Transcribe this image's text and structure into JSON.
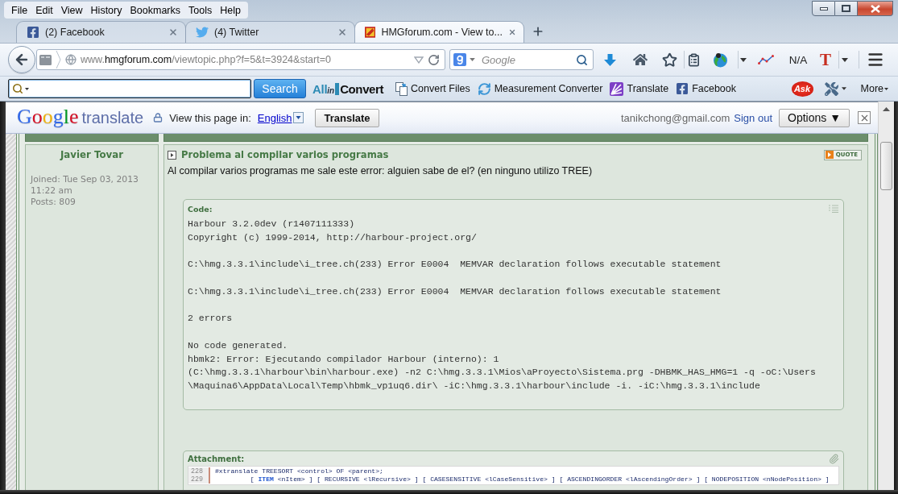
{
  "menu": [
    {
      "label": "File"
    },
    {
      "label": "Edit"
    },
    {
      "label": "View"
    },
    {
      "label": "History"
    },
    {
      "label": "Bookmarks"
    },
    {
      "label": "Tools"
    },
    {
      "label": "Help"
    }
  ],
  "tabs": [
    {
      "label": "(2) Facebook",
      "selected": false
    },
    {
      "label": "(4) Twitter",
      "selected": false
    },
    {
      "label": "HMGforum.com - View to...",
      "selected": true
    }
  ],
  "address_bar": {
    "url_prefix": "www.",
    "url_domain": "hmgforum.com",
    "url_path": "/viewtopic.php?f=5&t=3924&start=0"
  },
  "search_field": {
    "placeholder": "Google"
  },
  "nav_toolbar": {
    "status_text": "N/A",
    "letter_button": "T"
  },
  "bookmarks_bar": {
    "search_button": "Search",
    "logo": {
      "part_1": "All",
      "part_2": "in",
      "part_3": "Convert"
    },
    "items": [
      {
        "label": "Convert Files"
      },
      {
        "label": "Measurement Converter"
      },
      {
        "label": "Translate"
      },
      {
        "label": "Facebook"
      }
    ],
    "ask_logo": "Ask",
    "more_button": "More"
  },
  "translate_bar": {
    "logo_word": "Google",
    "logo_product": "translate",
    "prompt": "View this page in:",
    "language": "English",
    "translate_button": "Translate",
    "account": "tanikchong@gmail.com",
    "sign_out": "Sign out",
    "options_button": "Options ▼"
  },
  "topic": {
    "author": {
      "name": "Javier Tovar",
      "joined": "Joined: Tue Sep 03, 2013 11:22 am",
      "posts": "Posts: 809"
    },
    "post": {
      "title": "Problema al compilar varios programas",
      "quote_button": "QUOTE",
      "body": "Al compilar varios programas me sale este error: alguien sabe de el? (en ninguno utilizo TREE)",
      "code": {
        "label": "Code:",
        "text": "Harbour 3.2.0dev (r1407111333)\nCopyright (c) 1999-2014, http://harbour-project.org/\n\nC:\\hmg.3.3.1\\include\\i_tree.ch(233) Error E0004  MEMVAR declaration follows executable statement\n\nC:\\hmg.3.3.1\\include\\i_tree.ch(233) Error E0004  MEMVAR declaration follows executable statement\n\n2 errors\n\nNo code generated.\nhbmk2: Error: Ejecutando compilador Harbour (interno): 1\n(C:\\hmg.3.3.1\\harbour\\bin\\harbour.exe) -n2 C:\\hmg.3.3.1\\Mios\\aProyecto\\Sistema.prg -DHBMK_HAS_HMG=1 -q -oC:\\Users\n\\Maquina6\\AppData\\Local\\Temp\\hbmk_vp1uq6.dir\\ -iC:\\hmg.3.3.1\\harbour\\include -i. -iC:\\hmg.3.3.1\\include"
      },
      "attachment": {
        "label": "Attachment:",
        "lines": [
          {
            "number": "228",
            "text": "#xtranslate TREESORT <control> OF <parent>;"
          },
          {
            "number": "229",
            "text": "         [ **ITEM** <nItem> ] [ RECURSIVE <lRecursive> ] [ CASESENSITIVE <lCaseSensitive> ] [ ASCENDINGORDER <lAscendingOrder> ] [ NODEPOSITION <nNodePosition> ]"
          }
        ]
      }
    }
  }
}
